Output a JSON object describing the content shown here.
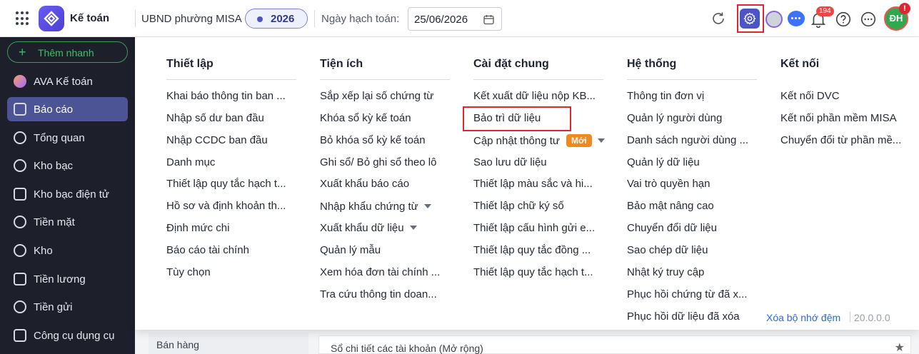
{
  "header": {
    "app_name": "Kế toán",
    "org_name": "UBND phường MISA",
    "year": "2026",
    "date_label": "Ngày hạch toán:",
    "date_value": "25/06/2026",
    "notification_count": "194",
    "avatar_initials": "ĐH",
    "avatar_alert": "!"
  },
  "sidebar": {
    "add_label": "Thêm nhanh",
    "items": [
      {
        "label": "AVA Kế toán",
        "icon": "ava-icon"
      },
      {
        "label": "Báo cáo",
        "icon": "report-icon",
        "active": true
      },
      {
        "label": "Tổng quan",
        "icon": "overview-icon"
      },
      {
        "label": "Kho bạc",
        "icon": "treasury-icon"
      },
      {
        "label": "Kho bạc điện tử",
        "icon": "e-treasury-icon"
      },
      {
        "label": "Tiền mặt",
        "icon": "cash-icon"
      },
      {
        "label": "Kho",
        "icon": "warehouse-icon"
      },
      {
        "label": "Tiền lương",
        "icon": "salary-icon"
      },
      {
        "label": "Tiền gửi",
        "icon": "deposit-icon"
      },
      {
        "label": "Công cụ dụng cụ",
        "icon": "tools-icon"
      }
    ]
  },
  "menu": {
    "columns": [
      {
        "title": "Thiết lập",
        "items": [
          "Khai báo thông tin ban ...",
          "Nhập số dư ban đầu",
          "Nhập CCDC ban đầu",
          "Danh mục",
          "Thiết lập quy tắc hạch t...",
          "Hồ sơ và định khoản th...",
          "Định mức chi",
          "Báo cáo tài chính",
          "Tùy chọn"
        ]
      },
      {
        "title": "Tiện ích",
        "items": [
          "Sắp xếp lại số chứng từ",
          "Khóa sổ kỳ kế toán",
          "Bỏ khóa sổ kỳ kế toán",
          "Ghi sổ/ Bỏ ghi sổ theo lô",
          "Xuất khẩu báo cáo",
          "Nhập khẩu chứng từ",
          "Xuất khẩu dữ liệu",
          "Quản lý mẫu",
          "Xem hóa đơn tài chính ...",
          "Tra cứu thông tin doan..."
        ]
      },
      {
        "title": "Cài đặt chung",
        "items": [
          "Kết xuất dữ liệu nộp KB...",
          "Bảo trì dữ liệu",
          "Cập nhật thông tư",
          "Sao lưu dữ liệu",
          "Thiết lập màu sắc và hi...",
          "Thiết lập chữ ký số",
          "Thiết lập cấu hình gửi e...",
          "Thiết lập quy tắc đồng ...",
          "Thiết lập quy tắc hạch t..."
        ],
        "new_badge": "Mới"
      },
      {
        "title": "Hệ thống",
        "items": [
          "Thông tin đơn vị",
          "Quản lý người dùng",
          "Danh sách người dùng ...",
          "Quản lý dữ liệu",
          "Vai trò quyền hạn",
          "Bảo mật nâng cao",
          "Chuyển đổi dữ liệu",
          "Sao chép dữ liệu",
          "Nhật ký truy cập",
          "Phục hồi chứng từ đã x...",
          "Phục hồi dữ liệu đã xóa"
        ]
      },
      {
        "title": "Kết nối",
        "items": [
          "Kết nối DVC",
          "Kết nối phần mềm MISA",
          "Chuyển đổi từ phần mề..."
        ]
      }
    ],
    "clear_cache": "Xóa bộ nhớ đệm",
    "version": "20.0.0.0"
  },
  "background": {
    "left_item": "Bán hàng",
    "report_title": "Sổ chi tiết các tài khoản (Mở rộng)"
  }
}
